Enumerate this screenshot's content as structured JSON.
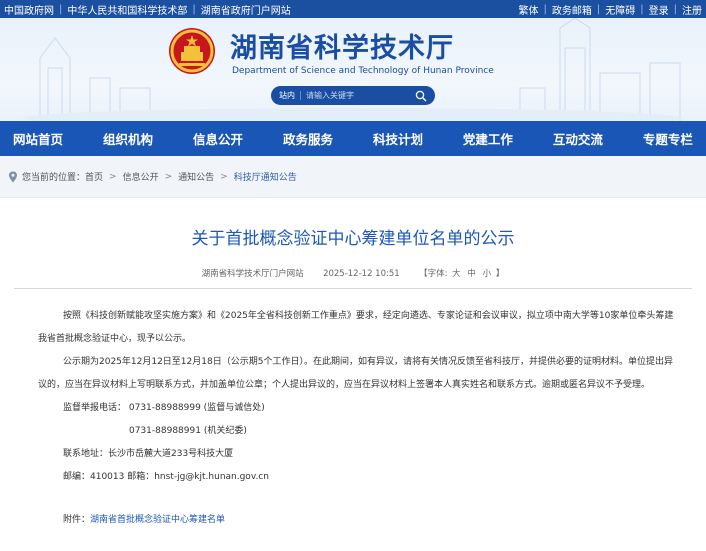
{
  "topbar": {
    "links_left": [
      "中国政府网",
      "中华人民共和国科学技术部",
      "湖南省政府门户网站"
    ],
    "links_right": [
      "繁体",
      "政务邮箱",
      "无障碍",
      "登录",
      "注册"
    ]
  },
  "header": {
    "title": "湖南省科学技术厅",
    "subtitle": "Department of Science and Technology of Hunan Province",
    "search": {
      "label": "站内",
      "placeholder": "请输入关键字"
    }
  },
  "nav": [
    "网站首页",
    "组织机构",
    "信息公开",
    "政务服务",
    "科技计划",
    "党建工作",
    "互动交流",
    "专题专栏"
  ],
  "breadcrumb": {
    "prefix": "您当前的位置：",
    "items": [
      "首页",
      "信息公开",
      "通知公告",
      "科技厅通知公告"
    ],
    "arrow": ">"
  },
  "article": {
    "title": "关于首批概念验证中心筹建单位名单的公示",
    "source": "湖南省科学技术厅门户网站",
    "date": "2025-12-12 10:51",
    "font_label": "【字体:",
    "font_sizes": [
      "大",
      "中",
      "小"
    ],
    "font_close": "】",
    "para1": "按照《科技创新赋能攻坚实施方案》和《2025年全省科技创新工作重点》要求，经定向遴选、专家论证和会议审议，拟立项中南大学等10家单位牵头筹建我省首批概念验证中心，现予以公示。",
    "para2": "公示期为2025年12月12日至12月18日（公示期5个工作日）。在此期间，如有异议，请将有关情况反馈至省科技厅，并提供必要的证明材料。单位提出异议的，应当在异议材料上写明联系方式，并加盖单位公章；个人提出异议的，应当在异议材料上签署本人真实姓名和联系方式。逾期或匿名异议不予受理。",
    "phone1": "监督举报电话：  0731-88988999  (监督与诚信处)",
    "phone2": "0731-88988991  (机关纪委)",
    "address": "联系地址：长沙市岳麓大道233号科技大厦",
    "postal": "邮编：410013  邮箱：hnst-jg@kjt.hunan.gov.cn",
    "attachment_label": "附件：",
    "attachment_link": "湖南省首批概念验证中心筹建名单"
  },
  "colors": {
    "topbar": "#1b4fa0",
    "nav": "#1a56b6",
    "title_blue": "#1a4ea3",
    "article_title": "#1b58b8"
  }
}
